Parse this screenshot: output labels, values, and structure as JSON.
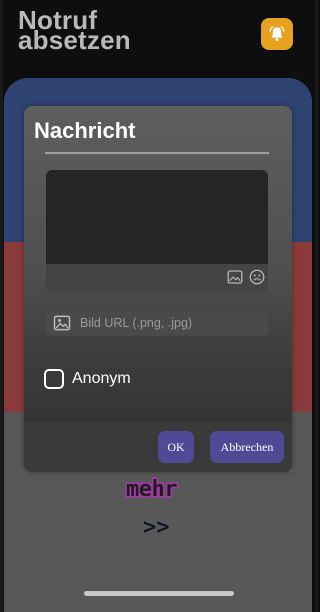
{
  "header": {
    "title_line1": "Notruf",
    "title_line2": "absetzen"
  },
  "header_button": {
    "icon": "bell-alarm-icon",
    "color": "#e6a21f"
  },
  "background_bands": {
    "blue": "#2f4372",
    "red": "#8a3a3a",
    "grey": "#585858"
  },
  "dialog": {
    "title": "Nachricht",
    "message_value": "",
    "toolbar_icons": [
      "image-icon",
      "emoji-icon"
    ],
    "image_url_placeholder": "Bild URL (.png, .jpg)",
    "anonymous_label": "Anonym",
    "anonymous_checked": false,
    "ok_label": "OK",
    "cancel_label": "Abbrechen",
    "button_color": "#514896"
  },
  "more_label": "mehr",
  "next_label": ">>"
}
